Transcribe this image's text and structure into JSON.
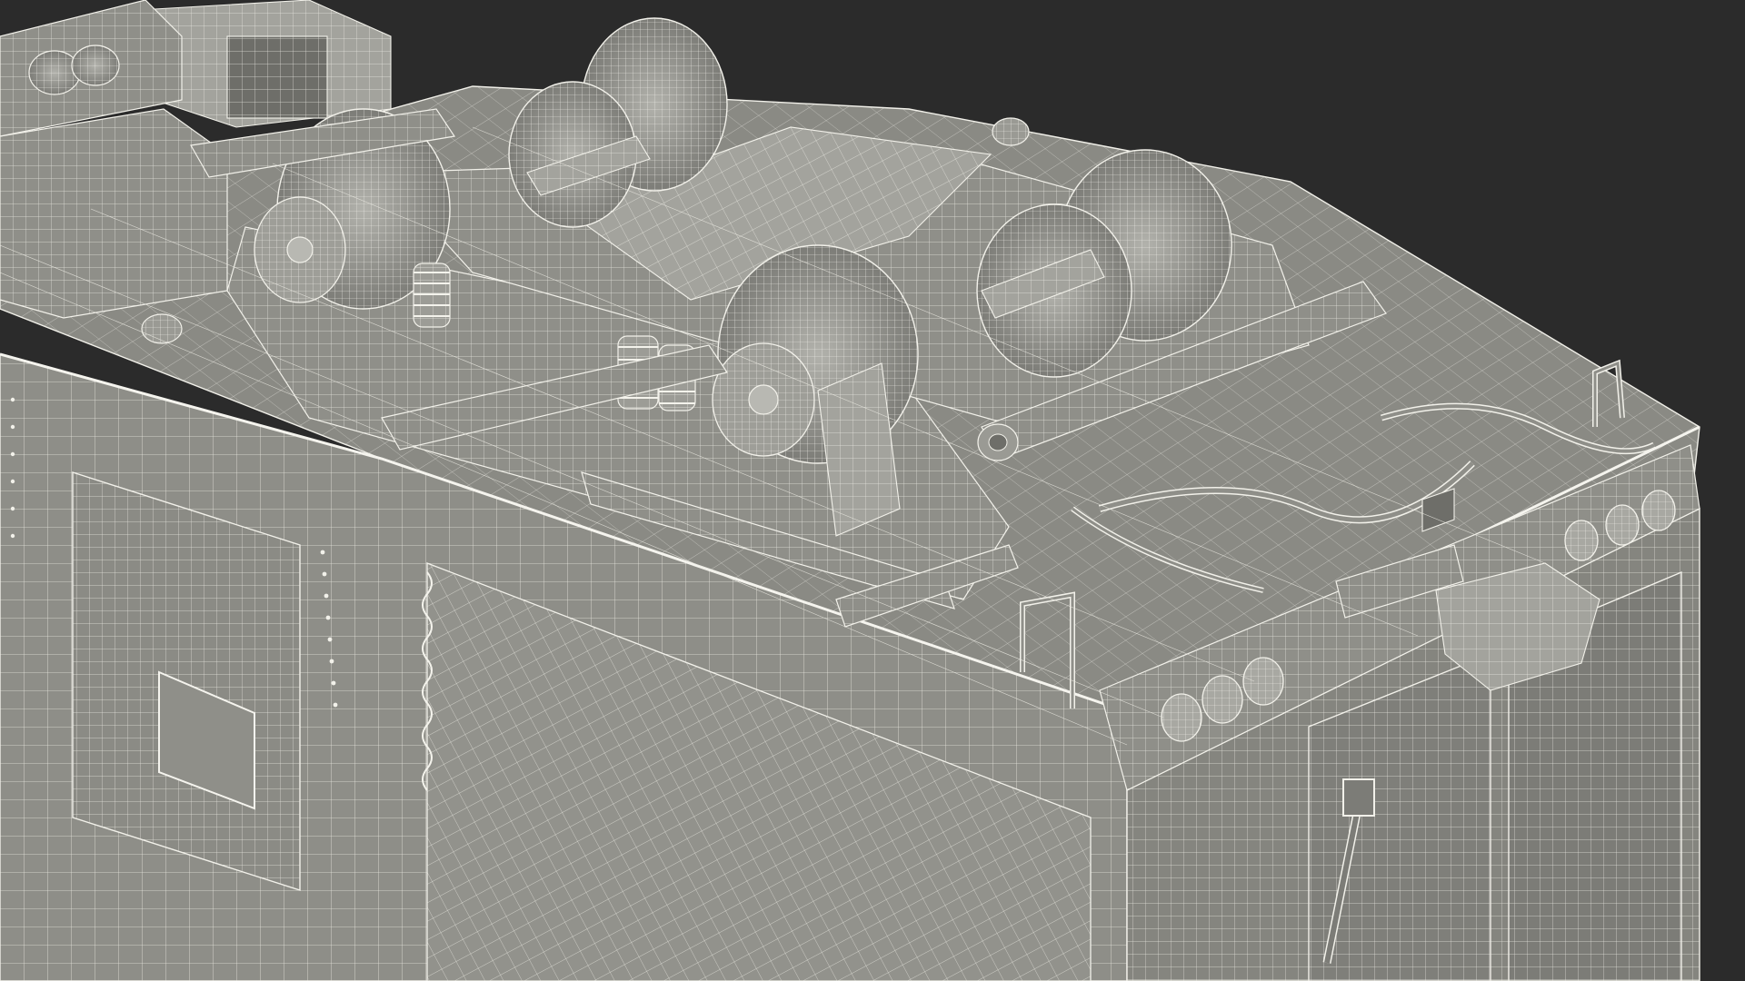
{
  "scene": {
    "subject": "wireframe-render",
    "colors": {
      "background": "#2b2b2b",
      "surface": "#8f8f89",
      "surface_dark": "#6e6e69",
      "surface_light": "#a3a39d",
      "wire": "#f2f1ea"
    }
  }
}
